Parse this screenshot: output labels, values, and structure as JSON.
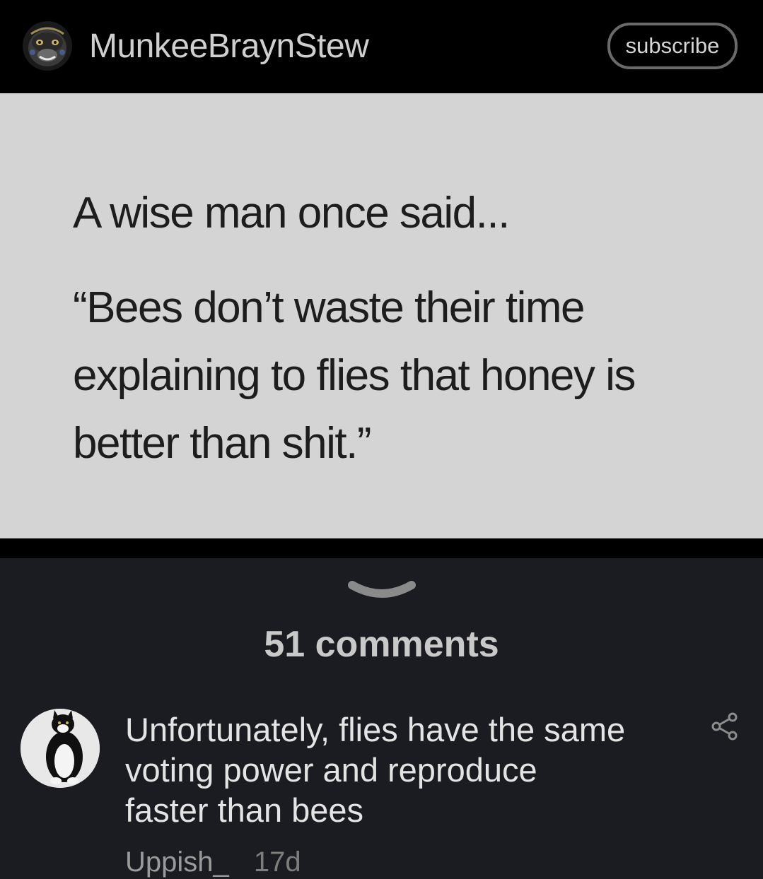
{
  "header": {
    "username": "MunkeeBraynStew",
    "subscribe_label": "subscribe",
    "avatar_icon": "gorilla-avatar"
  },
  "post": {
    "intro": "A wise man once said...",
    "quote_lines": [
      "“Bees don’t waste their time",
      "explaining to flies that honey is",
      "better than shit.”"
    ],
    "background_color": "#d4d4d4"
  },
  "comments_section": {
    "toggle_icon": "chevron-down-icon",
    "count_label": "51 comments"
  },
  "comment": {
    "lines": [
      "Unfortunately, flies have the same",
      "voting power and reproduce",
      "faster than bees"
    ],
    "author": "Uppish_",
    "age": "17d",
    "avatar_icon": "cat-avatar",
    "share_icon": "share-icon"
  }
}
